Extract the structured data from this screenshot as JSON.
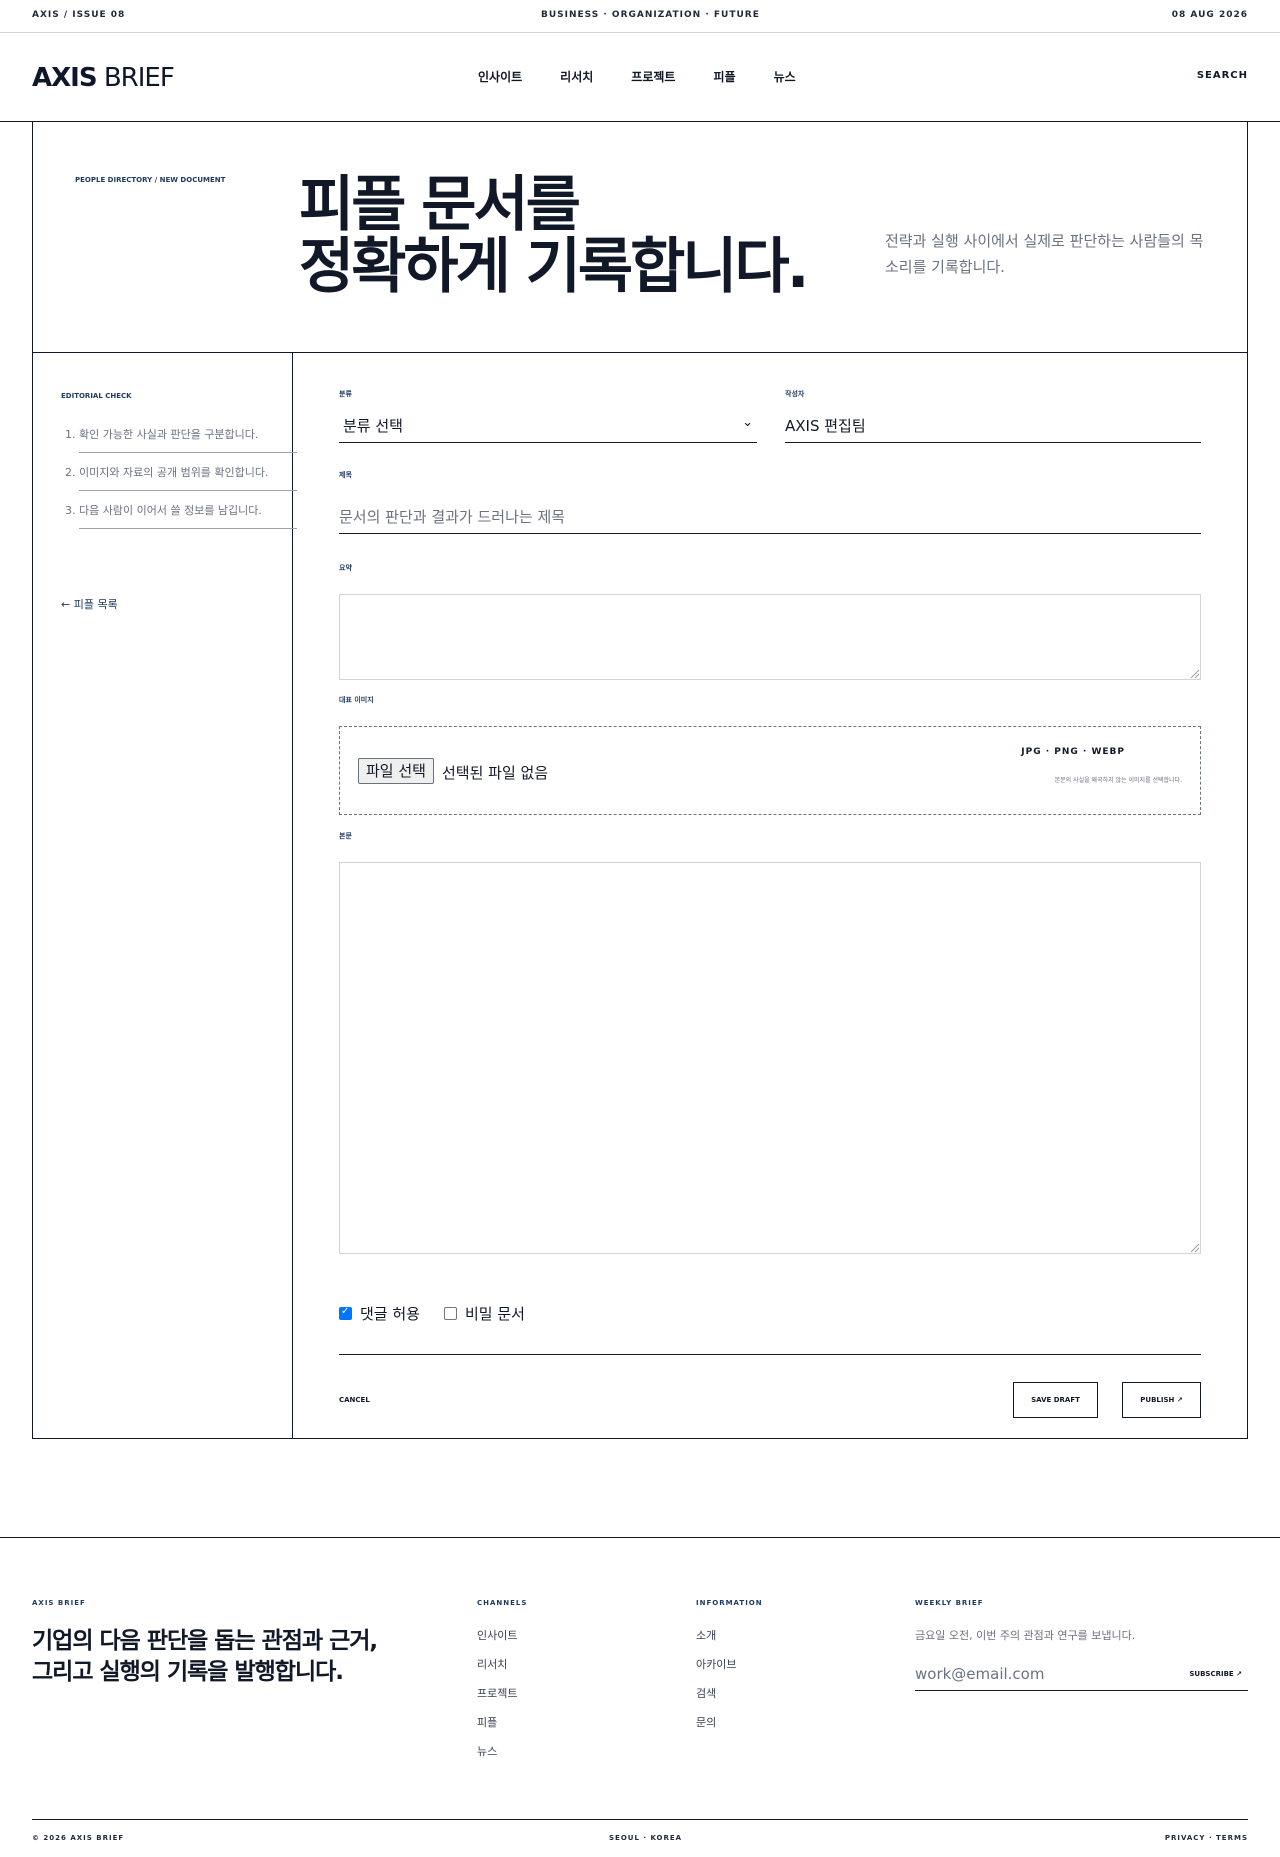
{
  "topbar": {
    "issue": "AXIS / ISSUE 08",
    "tagline": "BUSINESS · ORGANIZATION · FUTURE",
    "date": "08 AUG 2026"
  },
  "header": {
    "logo_bold": "AXIS",
    "logo_light": "BRIEF",
    "nav": [
      "인사이트",
      "리서치",
      "프로젝트",
      "피플",
      "뉴스"
    ],
    "search": "SEARCH"
  },
  "hero": {
    "breadcrumb": "PEOPLE DIRECTORY / NEW DOCUMENT",
    "title_line1": "피플 문서를",
    "title_line2": "정확하게 기록합니다.",
    "description": "전략과 실행 사이에서 실제로 판단하는 사람들의 목소리를 기록합니다."
  },
  "sidebar": {
    "heading": "EDITORIAL CHECK",
    "items": [
      "확인 가능한 사실과 판단을 구분합니다.",
      "이미지와 자료의 공개 범위를 확인합니다.",
      "다음 사람이 이어서 쓸 정보를 남깁니다."
    ],
    "back_link": "← 피플 목록"
  },
  "form": {
    "category_label": "분류",
    "category_value": "분류 선택",
    "author_label": "작성자",
    "author_value": "AXIS 편집팀",
    "title_label": "제목",
    "title_placeholder": "문서의 판단과 결과가 드러나는 제목",
    "summary_label": "요약",
    "image_label": "대표 이미지",
    "file_button": "파일 선택",
    "file_status": "선택된 파일 없음",
    "formats": "JPG · PNG · WEBP",
    "upload_hint": "본문의 사실을 왜곡하지 않는 이미지를 선택합니다.",
    "body_label": "본문",
    "allow_comments": "댓글 허용",
    "allow_comments_checked": true,
    "private_doc": "비밀 문서",
    "private_doc_checked": false,
    "cancel": "CANCEL",
    "save_draft": "SAVE DRAFT",
    "publish": "PUBLISH ↗"
  },
  "footer": {
    "brand": "AXIS BRIEF",
    "tagline_line1": "기업의 다음 판단을 돕는 관점과 근거,",
    "tagline_line2": "그리고 실행의 기록을 발행합니다.",
    "channels_heading": "CHANNELS",
    "channels": [
      "인사이트",
      "리서치",
      "프로젝트",
      "피플",
      "뉴스"
    ],
    "information_heading": "INFORMATION",
    "information": [
      "소개",
      "아카이브",
      "검색",
      "문의"
    ],
    "weekly_heading": "WEEKLY BRIEF",
    "weekly_desc": "금요일 오전, 이번 주의 관점과 연구를 보냅니다.",
    "email_placeholder": "work@email.com",
    "subscribe": "SUBSCRIBE ↗",
    "copyright": "© 2026 AXIS BRIEF",
    "location": "SEOUL · KOREA",
    "legal": "PRIVACY · TERMS"
  }
}
